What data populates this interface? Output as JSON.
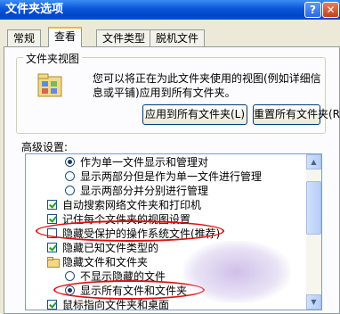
{
  "window": {
    "title": "文件夹选项",
    "help_label": "?",
    "close_label": "✕"
  },
  "tabs": [
    {
      "label": "常规",
      "active": false
    },
    {
      "label": "查看",
      "active": true
    },
    {
      "label": "文件类型",
      "active": false
    },
    {
      "label": "脱机文件",
      "active": false
    }
  ],
  "folder_views": {
    "legend": "文件夹视图",
    "description": "您可以将正在为此文件夹使用的视图(例如详细信息或平铺)应用到所有文件夹。",
    "apply_button": "应用到所有文件夹(L)",
    "reset_button": "重置所有文件夹(R)"
  },
  "advanced": {
    "label": "高级设置:",
    "items": [
      {
        "type": "radio",
        "checked": true,
        "indent": 2,
        "label": "作为单一文件显示和管理对"
      },
      {
        "type": "radio",
        "checked": false,
        "indent": 2,
        "label": "显示两部分但是作为单一文件进行管理"
      },
      {
        "type": "radio",
        "checked": false,
        "indent": 2,
        "label": "显示两部分并分别进行管理"
      },
      {
        "type": "check",
        "checked": true,
        "indent": 1,
        "label": "自动搜索网络文件夹和打印机"
      },
      {
        "type": "check",
        "checked": true,
        "indent": 1,
        "label": "记住每个文件夹的视图设置"
      },
      {
        "type": "check",
        "checked": false,
        "indent": 1,
        "label": "隐藏受保护的操作系统文件(推荐)"
      },
      {
        "type": "check",
        "checked": true,
        "indent": 1,
        "label": "隐藏已知文件类型的"
      },
      {
        "type": "folder",
        "checked": false,
        "indent": 1,
        "label": "隐藏文件和文件夹"
      },
      {
        "type": "radio",
        "checked": false,
        "indent": 2,
        "label": "不显示隐藏的文件"
      },
      {
        "type": "radio",
        "checked": true,
        "indent": 2,
        "label": "显示所有文件和文件夹"
      },
      {
        "type": "check",
        "checked": true,
        "indent": 1,
        "label": "鼠标指向文件夹和桌面"
      }
    ]
  }
}
